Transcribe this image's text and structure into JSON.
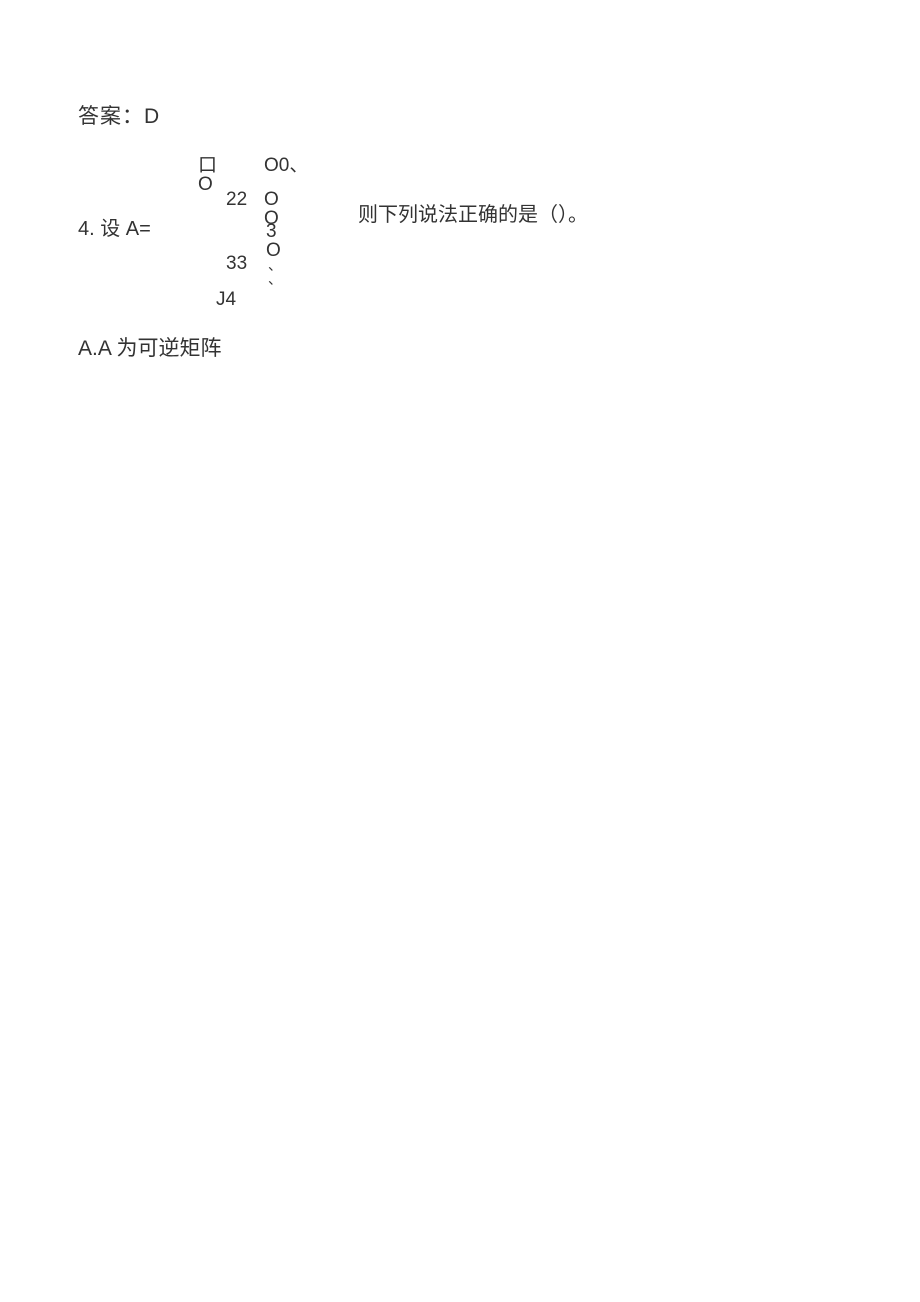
{
  "answer_prev": {
    "label": "答案：D"
  },
  "q4": {
    "prefix": "4. 设 A=",
    "matrix": {
      "r1a": "口 O",
      "r1b": "O0、",
      "r2a": "22",
      "r2b": "O O",
      "r3": "3 O",
      "r4a": "33",
      "r4b": "、 、",
      "r5": "J4"
    },
    "tail": "则下列说法正确的是（）。"
  },
  "optionA": "A.A 为可逆矩阵"
}
